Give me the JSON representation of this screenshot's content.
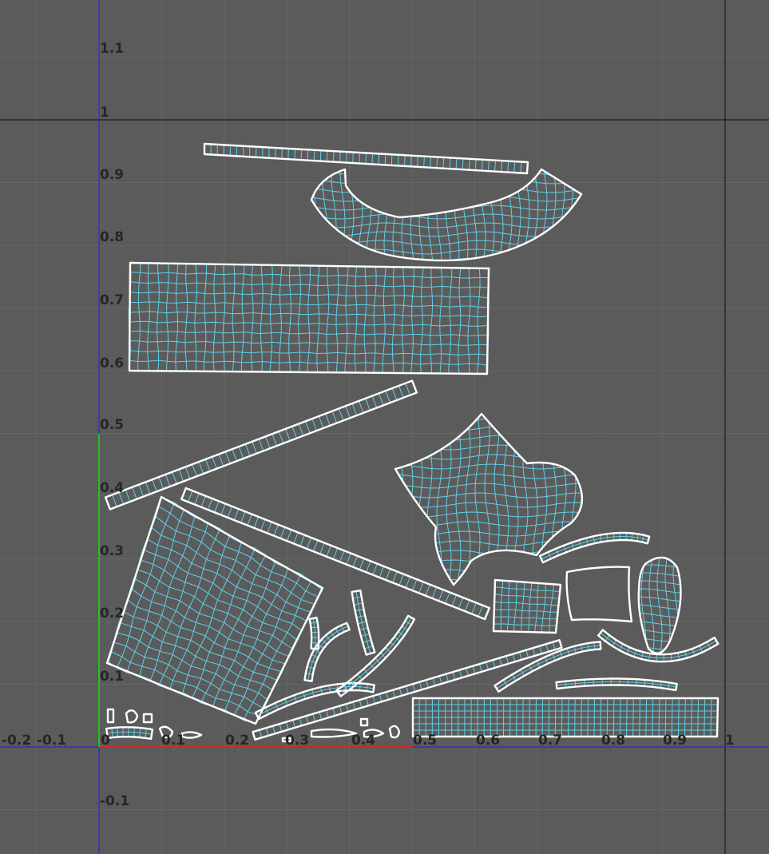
{
  "viewport": {
    "name": "UV Editor",
    "background_color": "#5b5b5b",
    "grid_color": "#666666",
    "unit_square_border_color": "#1a1a1a",
    "u_axis_color": "#e02020",
    "v_axis_color": "#22c022",
    "axis_line_color": "#2b2bc8",
    "label_color": "#262626"
  },
  "axes": {
    "u_labels": [
      "-0.2",
      "-0.1",
      "0",
      "0.1",
      "0.2",
      "0.3",
      "0.4",
      "0.5",
      "0.6",
      "0.7",
      "0.8",
      "0.9",
      "1"
    ],
    "v_labels": [
      "1.1",
      "1",
      "0.9",
      "0.8",
      "0.7",
      "0.6",
      "0.5",
      "0.4",
      "0.3",
      "0.2",
      "0.1",
      "-0.1"
    ]
  },
  "uv_shells": {
    "outline_color": "#ffffff",
    "mesh_color": "#5fd7f0",
    "items": [
      {
        "id": "top-strip",
        "kind": "strip"
      },
      {
        "id": "crescent",
        "kind": "curved-patch"
      },
      {
        "id": "large-rectangle",
        "kind": "grid-patch"
      },
      {
        "id": "diagonal-strip",
        "kind": "strip"
      },
      {
        "id": "star-patch",
        "kind": "organic-patch"
      },
      {
        "id": "skewed-quad",
        "kind": "grid-patch"
      },
      {
        "id": "long-diagonal-strip",
        "kind": "strip"
      },
      {
        "id": "small-square",
        "kind": "grid-patch"
      },
      {
        "id": "square-ring",
        "kind": "ring"
      },
      {
        "id": "oval-patch",
        "kind": "organic-patch"
      },
      {
        "id": "bottom-rectangle",
        "kind": "grid-patch"
      },
      {
        "id": "small-pieces",
        "kind": "misc"
      }
    ]
  }
}
